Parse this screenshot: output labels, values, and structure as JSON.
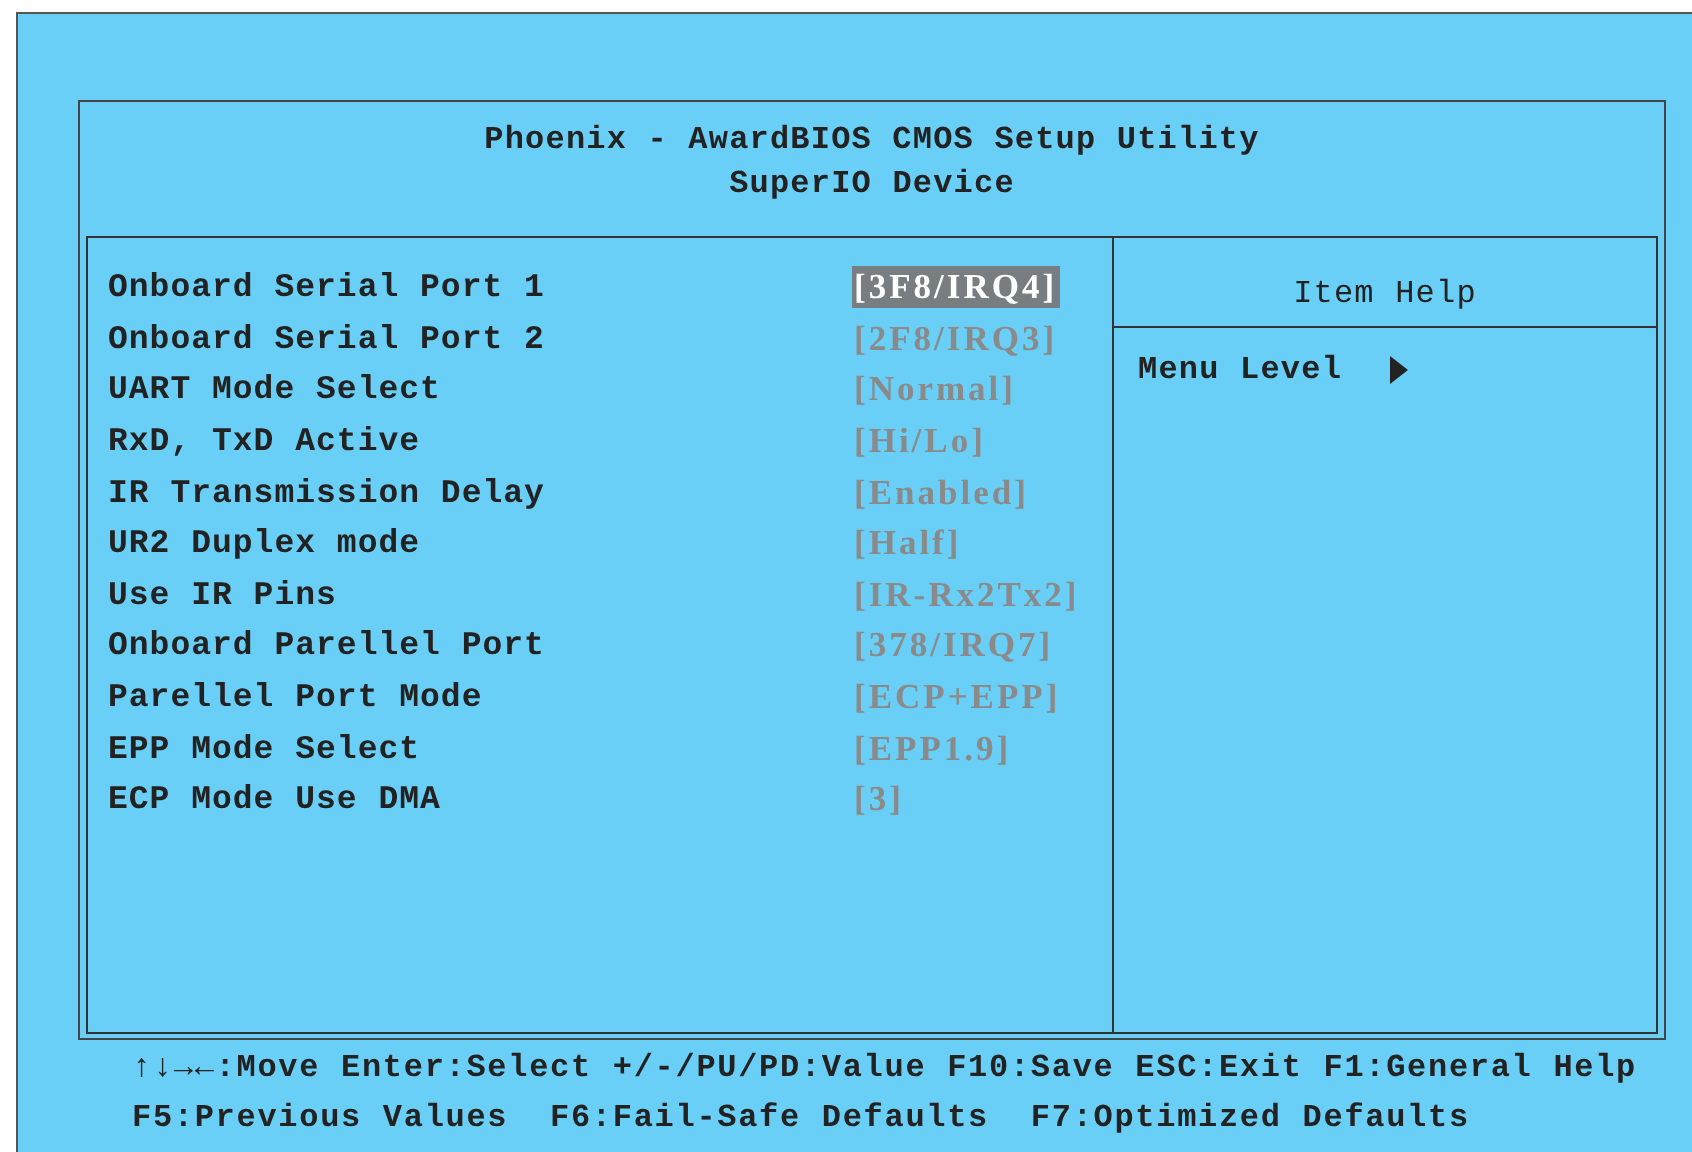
{
  "header": {
    "title": "Phoenix - AwardBIOS CMOS Setup Utility",
    "subtitle": "SuperIO Device"
  },
  "settings": [
    {
      "label": "Onboard Serial Port 1",
      "value": "[3F8/IRQ4]",
      "selected": true
    },
    {
      "label": "Onboard Serial Port 2",
      "value": "[2F8/IRQ3]",
      "selected": false
    },
    {
      "label": "UART Mode Select",
      "value": "[Normal]",
      "selected": false
    },
    {
      "label": "RxD, TxD Active",
      "value": "[Hi/Lo]",
      "selected": false
    },
    {
      "label": "IR Transmission Delay",
      "value": "[Enabled]",
      "selected": false
    },
    {
      "label": "UR2 Duplex mode",
      "value": "[Half]",
      "selected": false
    },
    {
      "label": "Use IR Pins",
      "value": "[IR-Rx2Tx2]",
      "selected": false
    },
    {
      "label": "Onboard Parellel Port",
      "value": "[378/IRQ7]",
      "selected": false
    },
    {
      "label": "Parellel Port Mode",
      "value": "[ECP+EPP]",
      "selected": false
    },
    {
      "label": "EPP Mode Select",
      "value": "[EPP1.9]",
      "selected": false
    },
    {
      "label": "ECP Mode Use DMA",
      "value": "[3]",
      "selected": false
    }
  ],
  "help": {
    "title": "Item Help",
    "menu_level": "Menu Level"
  },
  "footer": [
    "↑↓→←:Move Enter:Select +/-/PU/PD:Value F10:Save ESC:Exit F1:General Help",
    "F5:Previous Values  F6:Fail-Safe Defaults  F7:Optimized Defaults"
  ]
}
